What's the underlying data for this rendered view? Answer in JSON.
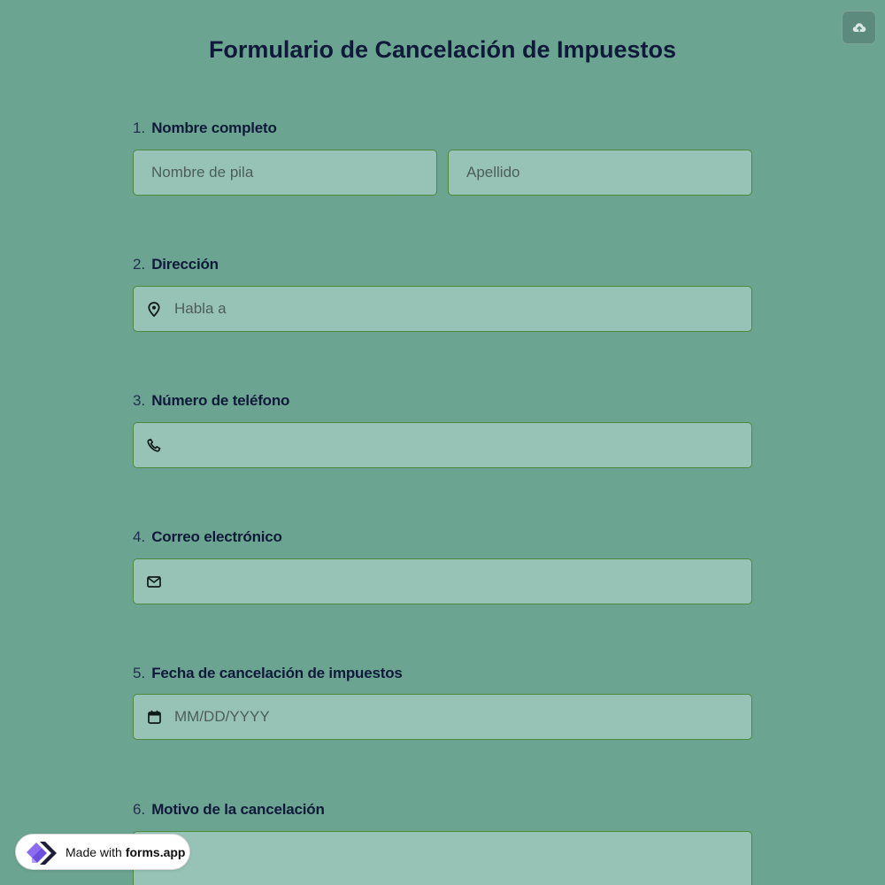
{
  "form": {
    "title": "Formulario de Cancelación de Impuestos"
  },
  "toolbar": {
    "upload_icon": "cloud-upload-icon"
  },
  "questions": [
    {
      "number": "1.",
      "label": "Nombre completo",
      "fields": [
        {
          "placeholder": "Nombre de pila",
          "value": ""
        },
        {
          "placeholder": "Apellido",
          "value": ""
        }
      ]
    },
    {
      "number": "2.",
      "label": "Dirección",
      "icon": "location-pin-icon",
      "placeholder": "Habla a",
      "value": ""
    },
    {
      "number": "3.",
      "label": "Número de teléfono",
      "icon": "phone-icon",
      "placeholder": "",
      "value": ""
    },
    {
      "number": "4.",
      "label": "Correo electrónico",
      "icon": "mail-icon",
      "placeholder": "",
      "value": ""
    },
    {
      "number": "5.",
      "label": "Fecha de cancelación de impuestos",
      "icon": "calendar-icon",
      "placeholder": "MM/DD/YYYY",
      "value": ""
    },
    {
      "number": "6.",
      "label": "Motivo de la cancelación",
      "placeholder": "",
      "value": ""
    }
  ],
  "badge": {
    "prefix": "Made with ",
    "brand": "forms.app"
  },
  "colors": {
    "background": "#6ba490",
    "field_background": "#97c3b6",
    "field_border": "#4e8a3e",
    "title": "#0f1a3a"
  }
}
